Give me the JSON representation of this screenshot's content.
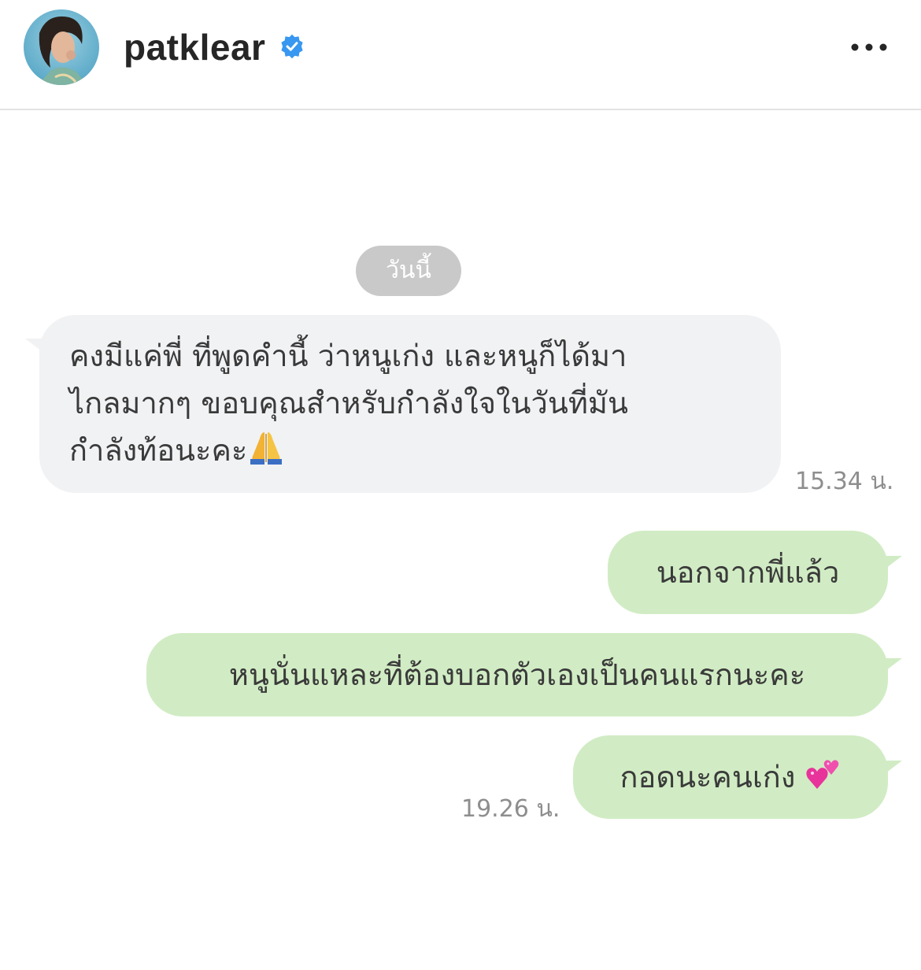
{
  "header": {
    "username": "patklear",
    "verified": true,
    "more_icon": "more-horizontal-icon",
    "avatar": "profile-avatar"
  },
  "chat": {
    "date_label": "วันนี้",
    "incoming": {
      "lines": [
        "คงมีแค่พี่ ที่พูดคำนี้  ว่าหนูเก่ง และหนูก็ได้มา",
        "ไกลมากๆ  ขอบคุณสำหรับกำลังใจในวันที่มัน",
        "กำลังท้อนะคะ"
      ],
      "emoji": "folded-hands-icon",
      "time": "15.34 น."
    },
    "outgoing": [
      {
        "text": "นอกจากพี่แล้ว"
      },
      {
        "text": "หนูนั่นแหละที่ต้องบอกตัวเองเป็นคนแรกนะคะ"
      },
      {
        "text": "กอดนะคนเก่ง ",
        "emoji": "two-hearts-icon"
      }
    ],
    "outgoing_time": "19.26 น."
  },
  "colors": {
    "incoming_bubble": "#f1f2f4",
    "outgoing_bubble": "#d1ecc4",
    "date_pill": "#c9c9c9",
    "verified_blue": "#3897f0"
  }
}
